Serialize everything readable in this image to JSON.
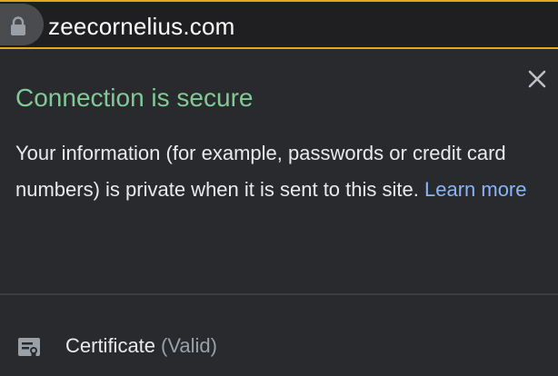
{
  "omnibox": {
    "url": "zeecornelius.com",
    "lock_icon": "lock-icon"
  },
  "bubble": {
    "title": "Connection is secure",
    "description": "Your information (for example, passwords or credit card numbers) is private when it is sent to this site.",
    "learn_more": "Learn more",
    "close_icon": "close-icon"
  },
  "certificate": {
    "label": "Certificate",
    "status": "(Valid)",
    "icon": "certificate-icon"
  },
  "colors": {
    "secure_green": "#81c995",
    "link_blue": "#8ab4f8",
    "focus_ring": "#e6a817",
    "background": "#292a2d"
  }
}
